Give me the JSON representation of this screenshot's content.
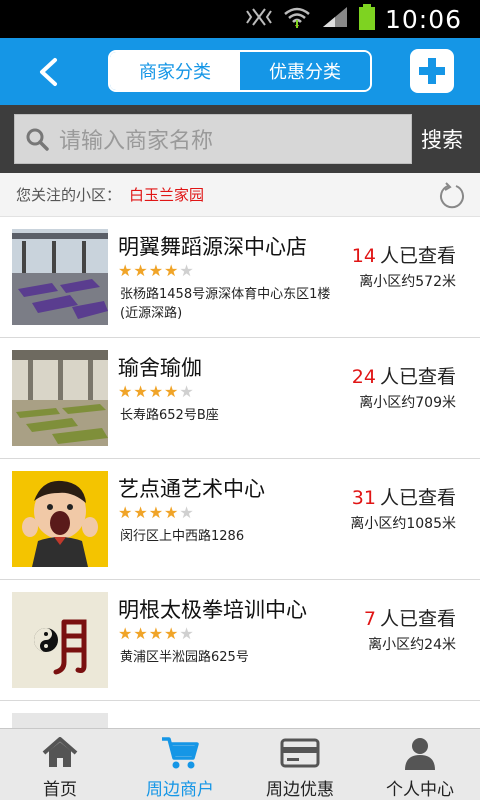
{
  "status_bar": {
    "time": "10:06"
  },
  "header": {
    "tabs": [
      {
        "label": "商家分类",
        "active": true
      },
      {
        "label": "优惠分类",
        "active": false
      }
    ]
  },
  "search": {
    "placeholder": "请输入商家名称",
    "button_label": "搜索"
  },
  "follow": {
    "label": "您关注的小区：",
    "community": "白玉兰家园"
  },
  "merchants": [
    {
      "name": "明翼舞蹈源深中心店",
      "rating": 4,
      "max_rating": 5,
      "address": "张杨路1458号源深体育中心东区1楼(近源深路)",
      "view_count": "14",
      "view_suffix": "人已查看",
      "distance": "离小区约572米",
      "thumb": "dance-studio"
    },
    {
      "name": "瑜舍瑜伽",
      "rating": 4,
      "max_rating": 5,
      "address": "长寿路652号B座",
      "view_count": "24",
      "view_suffix": "人已查看",
      "distance": "离小区约709米",
      "thumb": "yoga-studio"
    },
    {
      "name": "艺点通艺术中心",
      "rating": 4,
      "max_rating": 5,
      "address": "闵行区上中西路1286",
      "view_count": "31",
      "view_suffix": "人已查看",
      "distance": "离小区约1085米",
      "thumb": "child-shouting"
    },
    {
      "name": "明根太极拳培训中心",
      "rating": 4,
      "max_rating": 5,
      "address": "黄浦区半淞园路625号",
      "view_count": "7",
      "view_suffix": "人已查看",
      "distance": "离小区约24米",
      "thumb": "taichi-logo"
    }
  ],
  "nav": [
    {
      "label": "首页",
      "icon": "home-icon",
      "active": false
    },
    {
      "label": "周边商户",
      "icon": "cart-icon",
      "active": true
    },
    {
      "label": "周边优惠",
      "icon": "card-icon",
      "active": false
    },
    {
      "label": "个人中心",
      "icon": "user-icon",
      "active": false
    }
  ],
  "colors": {
    "primary": "#1596e6",
    "highlight": "#e01515",
    "star": "#f0a428"
  }
}
